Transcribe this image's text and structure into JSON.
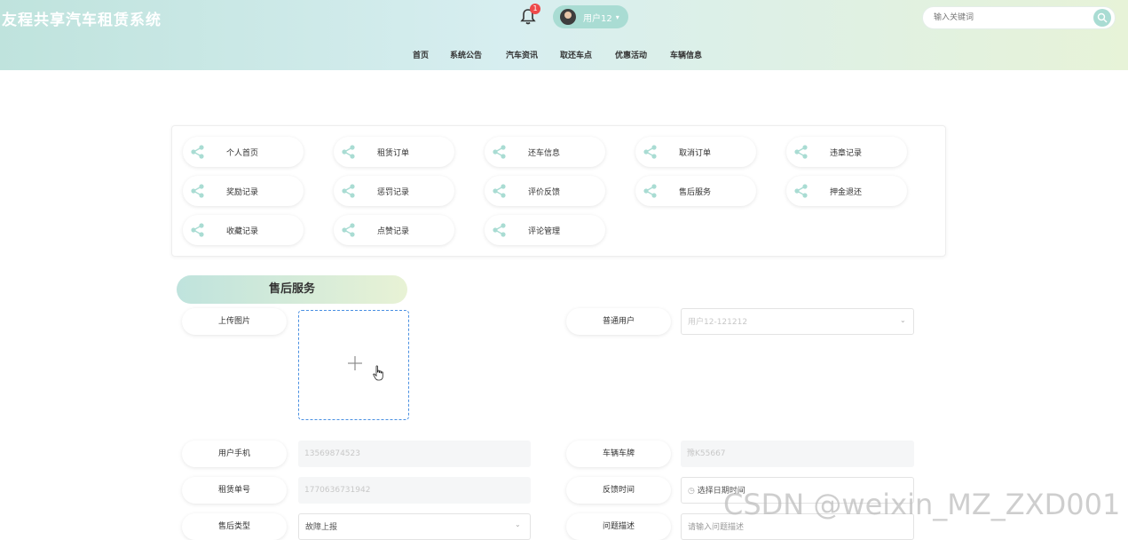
{
  "header": {
    "site_title": "友程共享汽车租赁系统",
    "notification_count": "1",
    "user_name": "用户12",
    "search_placeholder": "输入关键词"
  },
  "nav": {
    "items": [
      {
        "label": "首页"
      },
      {
        "label": "系统公告"
      },
      {
        "label": "汽车资讯"
      },
      {
        "label": "取还车点"
      },
      {
        "label": "优惠活动"
      },
      {
        "label": "车辆信息"
      }
    ]
  },
  "menu": {
    "items": [
      {
        "label": "个人首页"
      },
      {
        "label": "租赁订单"
      },
      {
        "label": "还车信息"
      },
      {
        "label": "取消订单"
      },
      {
        "label": "违章记录"
      },
      {
        "label": "奖励记录"
      },
      {
        "label": "惩罚记录"
      },
      {
        "label": "评价反馈"
      },
      {
        "label": "售后服务"
      },
      {
        "label": "押金退还"
      },
      {
        "label": "收藏记录"
      },
      {
        "label": "点赞记录"
      },
      {
        "label": "评论管理"
      }
    ]
  },
  "form": {
    "section_title": "售后服务",
    "upload_label": "上传图片",
    "user_type_label": "普通用户",
    "user_type_value": "用户12-121212",
    "phone_label": "用户手机",
    "phone_value": "13569874523",
    "plate_label": "车辆车牌",
    "plate_value": "豫K55667",
    "order_label": "租赁单号",
    "order_value": "1770636731942",
    "feedback_time_label": "反馈时间",
    "feedback_time_placeholder": "选择日期时间",
    "service_type_label": "售后类型",
    "service_type_value": "故障上报",
    "problem_label": "问题描述",
    "problem_placeholder": "请输入问题描述"
  },
  "watermark": "CSDN @weixin_MZ_ZXD001",
  "colors": {
    "header_gradient_start": "#bfe3dd",
    "header_gradient_end": "#e7f3d8",
    "accent": "#a9dcd3",
    "badge": "#ee4a4a",
    "upload_border": "#4a90e2"
  }
}
